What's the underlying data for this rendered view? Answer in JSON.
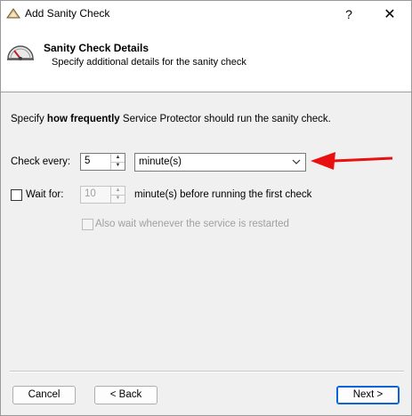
{
  "window": {
    "title": "Add Sanity Check",
    "help_glyph": "?",
    "close_glyph": "✕"
  },
  "header": {
    "title": "Sanity Check Details",
    "subtitle": "Specify additional details for the sanity check",
    "icon": "gauge-icon"
  },
  "description": {
    "prefix": "Specify ",
    "emphasis": "how frequently",
    "suffix": " Service Protector should run the sanity check."
  },
  "check_every": {
    "label": "Check every:",
    "value": "5",
    "unit_selected": "minute(s)"
  },
  "wait_for": {
    "label": "Wait for:",
    "checked": false,
    "value": "10",
    "suffix": "minute(s) before running the first check"
  },
  "also_wait": {
    "label": "Also wait whenever the service is restarted",
    "checked": false,
    "enabled": false
  },
  "buttons": {
    "cancel": "Cancel",
    "back": "< Back",
    "next": "Next >"
  },
  "colors": {
    "annotation_arrow": "#e81010",
    "default_button_border": "#0a64d6"
  }
}
